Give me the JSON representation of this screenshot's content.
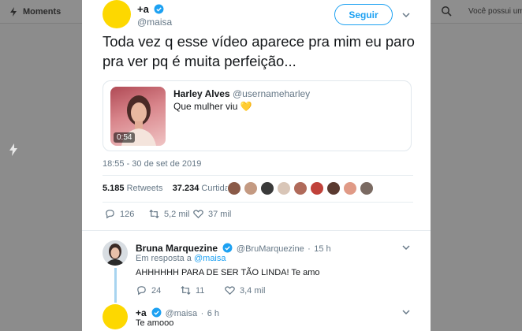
{
  "background": {
    "moments_label": "Moments",
    "notice_text": "Você possui uma"
  },
  "tweet": {
    "name": "+a",
    "handle": "@maisa",
    "follow_label": "Seguir",
    "text": "Toda vez q esse vídeo aparece pra mim eu paro pra ver pq é muita perfeição...",
    "timestamp": "18:55 - 30 de set de 2019",
    "retweets_count": "5.185",
    "retweets_label": "Retweets",
    "likes_count": "37.234",
    "likes_label": "Curtidas",
    "actions": {
      "replies": "126",
      "retweets": "5,2 mil",
      "likes": "37 mil"
    }
  },
  "quote": {
    "name": "Harley Alves",
    "handle": "@usernameharley",
    "text": "Que mulher viu",
    "emoji": "💛",
    "duration": "0:54"
  },
  "reply1": {
    "name": "Bruna Marquezine",
    "handle": "@BruMarquezine",
    "time": "15 h",
    "in_reply_prefix": "Em resposta a",
    "in_reply_handle": "@maisa",
    "text": "AHHHHHH PARA DE SER TÃO LINDA! Te amo",
    "actions": {
      "replies": "24",
      "retweets": "11",
      "likes": "3,4 mil"
    }
  },
  "reply2": {
    "name": "+a",
    "handle": "@maisa",
    "time": "6 h",
    "text": "Te amooo"
  },
  "colors": {
    "accent": "#1da1f2",
    "avatar_yellow": "#fdd800",
    "overlay": "#8c8c8c",
    "muted_text": "#657786"
  }
}
